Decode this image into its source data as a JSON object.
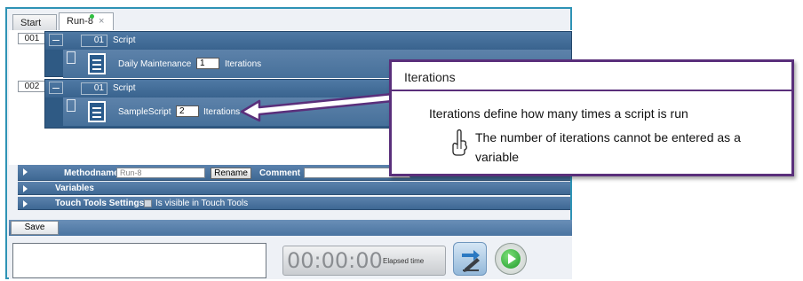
{
  "tabs": [
    {
      "label": "Start"
    },
    {
      "label": "Run-8"
    }
  ],
  "steps": [
    {
      "number": "001",
      "index": "01",
      "title": "Script",
      "script_name": "Daily Maintenance",
      "iterations": "1",
      "iterations_label": "Iterations"
    },
    {
      "number": "002",
      "index": "01",
      "title": "Script",
      "script_name": "SampleScript",
      "iterations": "2",
      "iterations_label": "Iterations"
    }
  ],
  "method_panel": {
    "methodname_label": "Methodname",
    "methodname_value": "Run-8",
    "rename_label": "Rename",
    "comment_label": "Comment"
  },
  "variables_panel": {
    "label": "Variables"
  },
  "touch_panel": {
    "label": "Touch Tools Settings",
    "checkbox_label": "Is visible in Touch Tools"
  },
  "save_label": "Save",
  "timer": {
    "value": "00:00:00",
    "caption": "Elapsed time"
  },
  "callout": {
    "title": "Iterations",
    "text": "Iterations define how many times a script is run",
    "note": "The number of iterations cannot be entered as a variable"
  },
  "colors": {
    "frame": "#2e93b5",
    "block": "#2f5a84",
    "callout_border": "#5a2f7b",
    "run_dot": "#2fbf40"
  }
}
